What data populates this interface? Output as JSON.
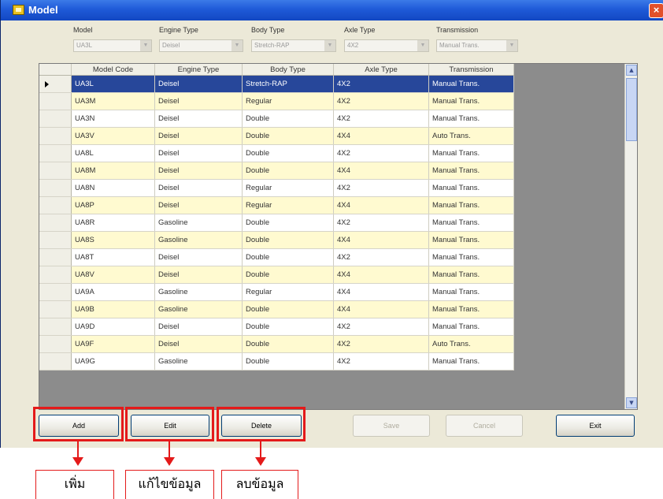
{
  "window": {
    "title": "Model",
    "close_label": "×"
  },
  "filters": [
    {
      "label": "Model",
      "value": "UA3L"
    },
    {
      "label": "Engine Type",
      "value": "Deisel"
    },
    {
      "label": "Body Type",
      "value": "Stretch-RAP"
    },
    {
      "label": "Axle Type",
      "value": "4X2"
    },
    {
      "label": "Transmission",
      "value": "Manual Trans."
    }
  ],
  "grid": {
    "columns": [
      "Model Code",
      "Engine Type",
      "Body Type",
      "Axle Type",
      "Transmission"
    ],
    "rows": [
      [
        "UA3L",
        "Deisel",
        "Stretch-RAP",
        "4X2",
        "Manual Trans."
      ],
      [
        "UA3M",
        "Deisel",
        "Regular",
        "4X2",
        "Manual Trans."
      ],
      [
        "UA3N",
        "Deisel",
        "Double",
        "4X2",
        "Manual Trans."
      ],
      [
        "UA3V",
        "Deisel",
        "Double",
        "4X4",
        "Auto Trans."
      ],
      [
        "UA8L",
        "Deisel",
        "Double",
        "4X2",
        "Manual Trans."
      ],
      [
        "UA8M",
        "Deisel",
        "Double",
        "4X4",
        "Manual Trans."
      ],
      [
        "UA8N",
        "Deisel",
        "Regular",
        "4X2",
        "Manual Trans."
      ],
      [
        "UA8P",
        "Deisel",
        "Regular",
        "4X4",
        "Manual Trans."
      ],
      [
        "UA8R",
        "Gasoline",
        "Double",
        "4X2",
        "Manual Trans."
      ],
      [
        "UA8S",
        "Gasoline",
        "Double",
        "4X4",
        "Manual Trans."
      ],
      [
        "UA8T",
        "Deisel",
        "Double",
        "4X2",
        "Manual Trans."
      ],
      [
        "UA8V",
        "Deisel",
        "Double",
        "4X4",
        "Manual Trans."
      ],
      [
        "UA9A",
        "Gasoline",
        "Regular",
        "4X4",
        "Manual Trans."
      ],
      [
        "UA9B",
        "Gasoline",
        "Double",
        "4X4",
        "Manual Trans."
      ],
      [
        "UA9D",
        "Deisel",
        "Double",
        "4X2",
        "Manual Trans."
      ],
      [
        "UA9F",
        "Deisel",
        "Double",
        "4X2",
        "Auto Trans."
      ],
      [
        "UA9G",
        "Gasoline",
        "Double",
        "4X2",
        "Manual Trans."
      ]
    ],
    "selected_row": 0
  },
  "buttons": {
    "add": "Add",
    "edit": "Edit",
    "delete": "Delete",
    "save": "Save",
    "cancel": "Cancel",
    "exit": "Exit"
  },
  "annotations": {
    "add": "เพิ่ม",
    "edit": "แก้ไขข้อมูล",
    "delete": "ลบข้อมูล",
    "color": "#e41a1a"
  },
  "colors": {
    "selected_row": "#27479a",
    "alt_row": "#fffad0",
    "titlebar": "#1f5ad8"
  }
}
